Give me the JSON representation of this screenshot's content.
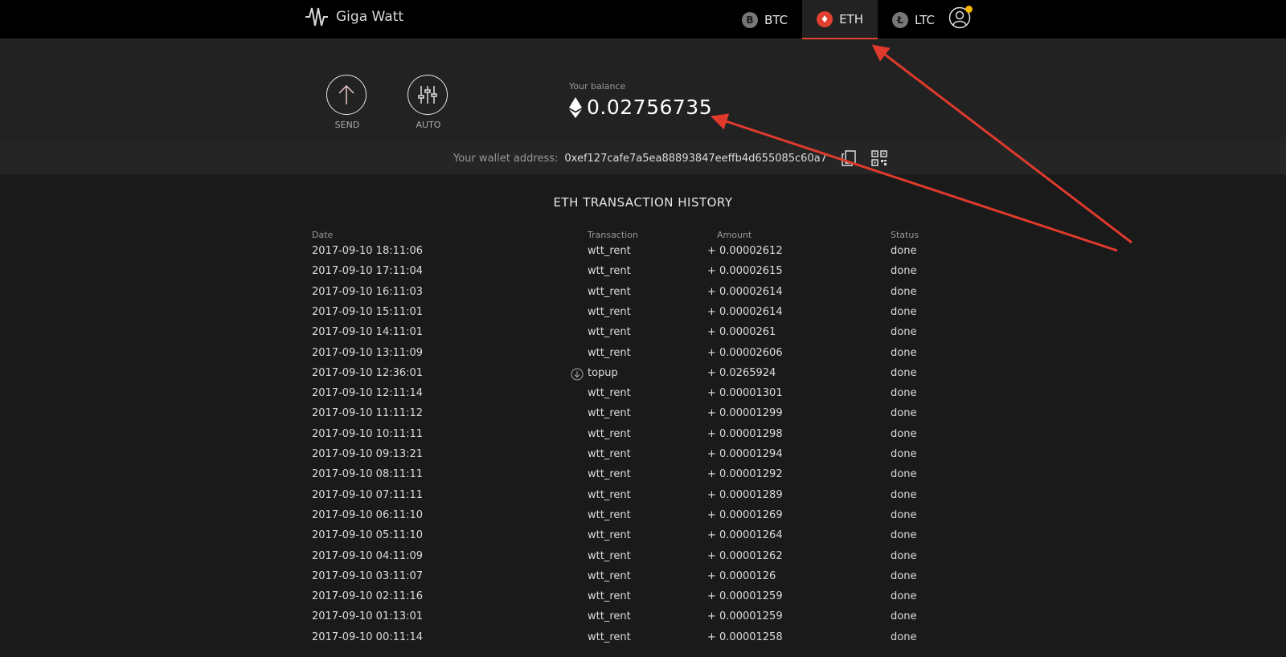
{
  "brand": {
    "name": "Giga Watt"
  },
  "nav": {
    "tabs": [
      {
        "symbol": "B",
        "label": "BTC",
        "active": false
      },
      {
        "symbol": "♦",
        "label": "ETH",
        "active": true
      },
      {
        "symbol": "Ł",
        "label": "LTC",
        "active": false
      }
    ],
    "accent_color": "#e0412f",
    "notification_color": "#f5b800"
  },
  "actions": {
    "send_label": "SEND",
    "auto_label": "AUTO"
  },
  "balance": {
    "label": "Your balance",
    "value": "0.02756735"
  },
  "wallet": {
    "label": "Your wallet address:",
    "address": "0xef127cafe7a5ea88893847eeffb4d655085c60a7"
  },
  "history": {
    "title": "ETH TRANSACTION HISTORY",
    "columns": {
      "date": "Date",
      "transaction": "Transaction",
      "amount": "Amount",
      "status": "Status"
    },
    "rows": [
      {
        "date": "2017-09-10 18:11:06",
        "tx": "wtt_rent",
        "amount": "+ 0.00002612",
        "status": "done"
      },
      {
        "date": "2017-09-10 17:11:04",
        "tx": "wtt_rent",
        "amount": "+ 0.00002615",
        "status": "done"
      },
      {
        "date": "2017-09-10 16:11:03",
        "tx": "wtt_rent",
        "amount": "+ 0.00002614",
        "status": "done"
      },
      {
        "date": "2017-09-10 15:11:01",
        "tx": "wtt_rent",
        "amount": "+ 0.00002614",
        "status": "done"
      },
      {
        "date": "2017-09-10 14:11:01",
        "tx": "wtt_rent",
        "amount": "+ 0.0000261",
        "status": "done"
      },
      {
        "date": "2017-09-10 13:11:09",
        "tx": "wtt_rent",
        "amount": "+ 0.00002606",
        "status": "done"
      },
      {
        "date": "2017-09-10 12:36:01",
        "tx": "topup",
        "amount": "+ 0.0265924",
        "status": "done",
        "icon": "download-circle-icon"
      },
      {
        "date": "2017-09-10 12:11:14",
        "tx": "wtt_rent",
        "amount": "+ 0.00001301",
        "status": "done"
      },
      {
        "date": "2017-09-10 11:11:12",
        "tx": "wtt_rent",
        "amount": "+ 0.00001299",
        "status": "done"
      },
      {
        "date": "2017-09-10 10:11:11",
        "tx": "wtt_rent",
        "amount": "+ 0.00001298",
        "status": "done"
      },
      {
        "date": "2017-09-10 09:13:21",
        "tx": "wtt_rent",
        "amount": "+ 0.00001294",
        "status": "done"
      },
      {
        "date": "2017-09-10 08:11:11",
        "tx": "wtt_rent",
        "amount": "+ 0.00001292",
        "status": "done"
      },
      {
        "date": "2017-09-10 07:11:11",
        "tx": "wtt_rent",
        "amount": "+ 0.00001289",
        "status": "done"
      },
      {
        "date": "2017-09-10 06:11:10",
        "tx": "wtt_rent",
        "amount": "+ 0.00001269",
        "status": "done"
      },
      {
        "date": "2017-09-10 05:11:10",
        "tx": "wtt_rent",
        "amount": "+ 0.00001264",
        "status": "done"
      },
      {
        "date": "2017-09-10 04:11:09",
        "tx": "wtt_rent",
        "amount": "+ 0.00001262",
        "status": "done"
      },
      {
        "date": "2017-09-10 03:11:07",
        "tx": "wtt_rent",
        "amount": "+ 0.0000126",
        "status": "done"
      },
      {
        "date": "2017-09-10 02:11:16",
        "tx": "wtt_rent",
        "amount": "+ 0.00001259",
        "status": "done"
      },
      {
        "date": "2017-09-10 01:13:01",
        "tx": "wtt_rent",
        "amount": "+ 0.00001259",
        "status": "done"
      },
      {
        "date": "2017-09-10 00:11:14",
        "tx": "wtt_rent",
        "amount": "+ 0.00001258",
        "status": "done"
      }
    ]
  },
  "annotations": {
    "arrow_color": "#e03a2c"
  }
}
